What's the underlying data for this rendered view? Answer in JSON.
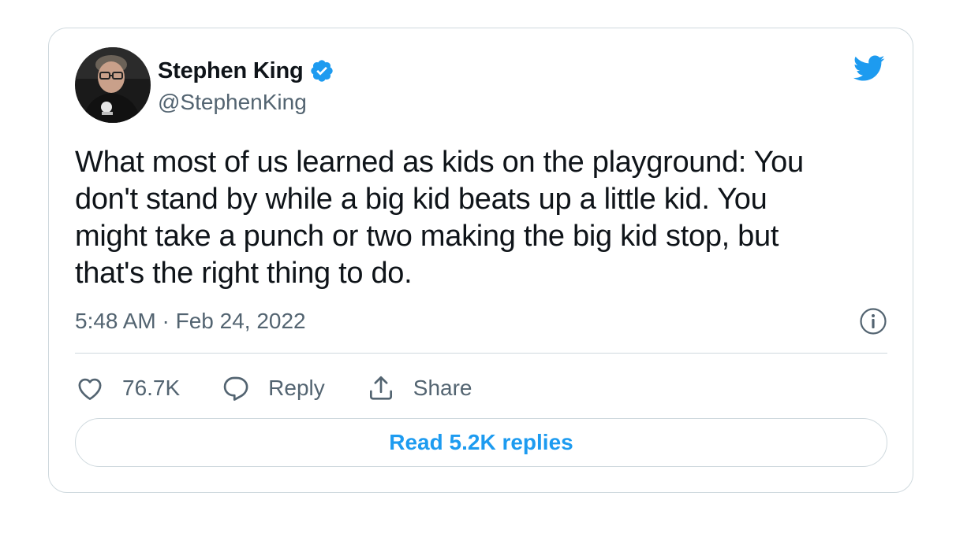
{
  "tweet": {
    "author": {
      "display_name": "Stephen King",
      "handle": "@StephenKing",
      "verified": true,
      "avatar_icon": "avatar-photo"
    },
    "text": "What most of us learned as kids on the playground: You\ndon't stand by while a big kid beats up a little kid. You\nmight take a punch or two making the big kid stop, but\nthat's the right thing to do.",
    "timestamp": "5:48 AM · Feb 24, 2022",
    "brand_icon": "twitter-bird-icon",
    "info_icon": "info-icon"
  },
  "actions": {
    "like_count": "76.7K",
    "reply_label": "Reply",
    "share_label": "Share"
  },
  "read_replies_label": "Read 5.2K replies",
  "colors": {
    "brand_blue": "#1d9bf0",
    "text_primary": "#0f1419",
    "text_secondary": "#536471",
    "border": "#cfd9de"
  }
}
